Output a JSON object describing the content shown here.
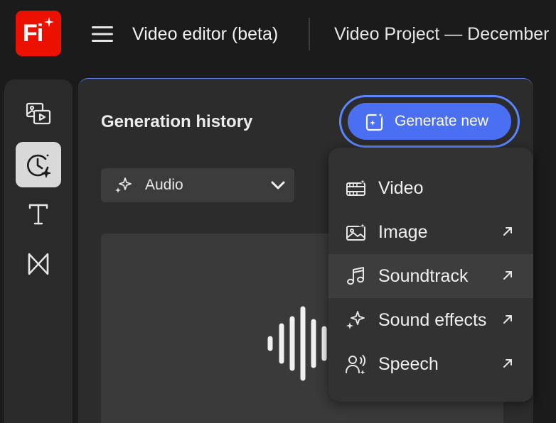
{
  "app": {
    "logo_text": "Fi",
    "title": "Video editor (beta)",
    "project_title": "Video Project — December"
  },
  "rail": {
    "items": [
      {
        "name": "media",
        "icon": "media-icon",
        "active": false
      },
      {
        "name": "generation-history",
        "icon": "history-sparkle-icon",
        "active": true
      },
      {
        "name": "text",
        "icon": "text-icon",
        "active": false
      },
      {
        "name": "transitions",
        "icon": "transition-icon",
        "active": false
      }
    ]
  },
  "panel": {
    "title": "Generation history",
    "generate_button": "Generate new",
    "filter": {
      "selected": "Audio",
      "icon": "sparkle-icon"
    }
  },
  "menu": {
    "items": [
      {
        "label": "Video",
        "icon": "video-sparkle-icon",
        "external": false
      },
      {
        "label": "Image",
        "icon": "image-sparkle-icon",
        "external": true
      },
      {
        "label": "Soundtrack",
        "icon": "music-note-icon",
        "external": true,
        "highlighted": true
      },
      {
        "label": "Sound effects",
        "icon": "sparkle-icon",
        "external": true
      },
      {
        "label": "Speech",
        "icon": "speech-icon",
        "external": true
      }
    ]
  },
  "colors": {
    "accent": "#4b6ff2",
    "accent_ring": "#5b84ff",
    "brand": "#eb1000",
    "background": "#1b1b1b",
    "panel": "#2c2c2c"
  }
}
